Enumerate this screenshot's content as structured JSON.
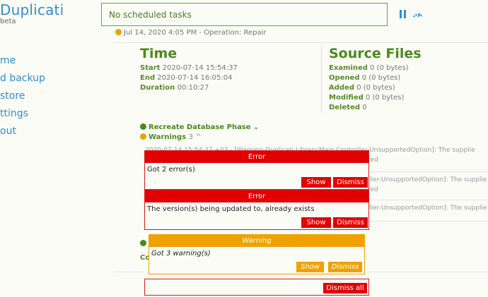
{
  "header": {
    "app_title": "Duplicati",
    "app_subtitle": "beta",
    "tasks_status": "No scheduled tasks"
  },
  "sidebar": {
    "items": [
      {
        "label": "me"
      },
      {
        "label": "d backup"
      },
      {
        "label": "store"
      },
      {
        "label": "ttings"
      },
      {
        "label": "out"
      }
    ]
  },
  "operation_line": "Jul 14, 2020 4:05 PM - Operation: Repair",
  "time": {
    "title": "Time",
    "start_label": "Start",
    "start_value": "2020-07-14 15:54:37",
    "end_label": "End",
    "end_value": "2020-07-14 16:05:04",
    "duration_label": "Duration",
    "duration_value": "00:10:27"
  },
  "source_files": {
    "title": "Source Files",
    "examined_label": "Examined",
    "examined_value": "0 (0 bytes)",
    "opened_label": "Opened",
    "opened_value": "0 (0 bytes)",
    "added_label": "Added",
    "added_value": "0 (0 bytes)",
    "modified_label": "Modified",
    "modified_value": "0 (0 bytes)",
    "deleted_label": "Deleted",
    "deleted_value": "0"
  },
  "phase": {
    "label": "Recreate Database Phase",
    "chevron": "⌄"
  },
  "warnings": {
    "label": "Warnings",
    "count": "3",
    "chevron": "^"
  },
  "log_lines": [
    {
      "text": "2020-07-14 15:54:37 +03 - [Warning-Duplicati.Library.Main.Controller-UnsupportedOption]: The supplie"
    },
    {
      "text": "red"
    },
    {
      "text": "ller-UnsupportedOption]: The supplie"
    },
    {
      "text": "red"
    },
    {
      "text": "ller-UnsupportedOption]: The supplie"
    }
  ],
  "bottom": {
    "co_label": "Co"
  },
  "notifications": [
    {
      "title": "Error",
      "message": "Got 2 error(s)",
      "show": "Show",
      "dismiss": "Dismiss"
    },
    {
      "title": "Error",
      "message": "The version(s) being updated to, already exists",
      "show": "Show",
      "dismiss": "Dismiss"
    },
    {
      "title": "Warning",
      "message": "Got 3 warning(s)",
      "show": "Show",
      "dismiss": "Dismiss"
    }
  ],
  "dismiss_all": "Dismiss all",
  "colors": {
    "error": "#e30000",
    "warning": "#f0a100",
    "brand_blue": "#2f8ed1",
    "green": "#4b8a1d"
  }
}
